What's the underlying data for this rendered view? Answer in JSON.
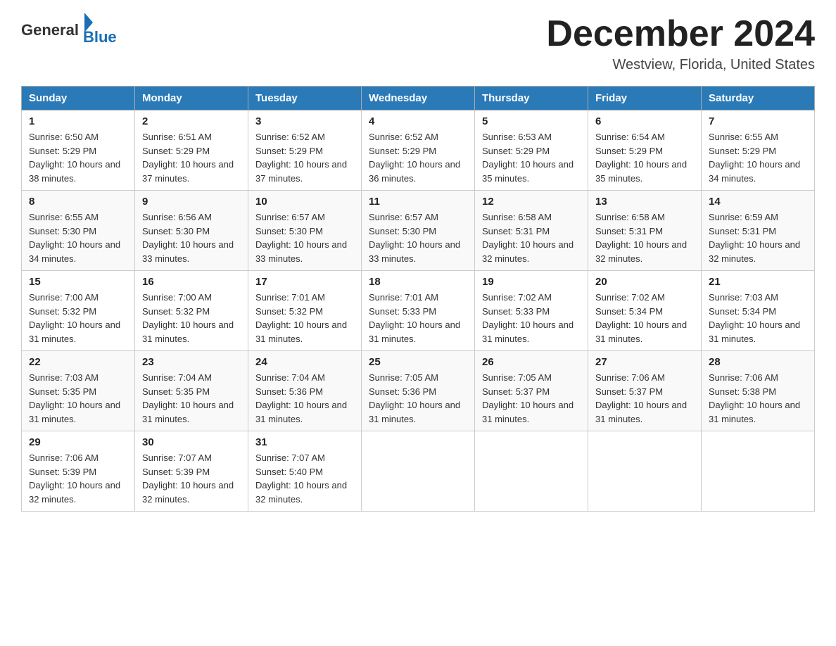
{
  "logo": {
    "text_general": "General",
    "text_blue": "Blue",
    "aria": "GeneralBlue logo"
  },
  "header": {
    "month_year": "December 2024",
    "location": "Westview, Florida, United States"
  },
  "weekdays": [
    "Sunday",
    "Monday",
    "Tuesday",
    "Wednesday",
    "Thursday",
    "Friday",
    "Saturday"
  ],
  "weeks": [
    [
      {
        "day": "1",
        "sunrise": "Sunrise: 6:50 AM",
        "sunset": "Sunset: 5:29 PM",
        "daylight": "Daylight: 10 hours and 38 minutes."
      },
      {
        "day": "2",
        "sunrise": "Sunrise: 6:51 AM",
        "sunset": "Sunset: 5:29 PM",
        "daylight": "Daylight: 10 hours and 37 minutes."
      },
      {
        "day": "3",
        "sunrise": "Sunrise: 6:52 AM",
        "sunset": "Sunset: 5:29 PM",
        "daylight": "Daylight: 10 hours and 37 minutes."
      },
      {
        "day": "4",
        "sunrise": "Sunrise: 6:52 AM",
        "sunset": "Sunset: 5:29 PM",
        "daylight": "Daylight: 10 hours and 36 minutes."
      },
      {
        "day": "5",
        "sunrise": "Sunrise: 6:53 AM",
        "sunset": "Sunset: 5:29 PM",
        "daylight": "Daylight: 10 hours and 35 minutes."
      },
      {
        "day": "6",
        "sunrise": "Sunrise: 6:54 AM",
        "sunset": "Sunset: 5:29 PM",
        "daylight": "Daylight: 10 hours and 35 minutes."
      },
      {
        "day": "7",
        "sunrise": "Sunrise: 6:55 AM",
        "sunset": "Sunset: 5:29 PM",
        "daylight": "Daylight: 10 hours and 34 minutes."
      }
    ],
    [
      {
        "day": "8",
        "sunrise": "Sunrise: 6:55 AM",
        "sunset": "Sunset: 5:30 PM",
        "daylight": "Daylight: 10 hours and 34 minutes."
      },
      {
        "day": "9",
        "sunrise": "Sunrise: 6:56 AM",
        "sunset": "Sunset: 5:30 PM",
        "daylight": "Daylight: 10 hours and 33 minutes."
      },
      {
        "day": "10",
        "sunrise": "Sunrise: 6:57 AM",
        "sunset": "Sunset: 5:30 PM",
        "daylight": "Daylight: 10 hours and 33 minutes."
      },
      {
        "day": "11",
        "sunrise": "Sunrise: 6:57 AM",
        "sunset": "Sunset: 5:30 PM",
        "daylight": "Daylight: 10 hours and 33 minutes."
      },
      {
        "day": "12",
        "sunrise": "Sunrise: 6:58 AM",
        "sunset": "Sunset: 5:31 PM",
        "daylight": "Daylight: 10 hours and 32 minutes."
      },
      {
        "day": "13",
        "sunrise": "Sunrise: 6:58 AM",
        "sunset": "Sunset: 5:31 PM",
        "daylight": "Daylight: 10 hours and 32 minutes."
      },
      {
        "day": "14",
        "sunrise": "Sunrise: 6:59 AM",
        "sunset": "Sunset: 5:31 PM",
        "daylight": "Daylight: 10 hours and 32 minutes."
      }
    ],
    [
      {
        "day": "15",
        "sunrise": "Sunrise: 7:00 AM",
        "sunset": "Sunset: 5:32 PM",
        "daylight": "Daylight: 10 hours and 31 minutes."
      },
      {
        "day": "16",
        "sunrise": "Sunrise: 7:00 AM",
        "sunset": "Sunset: 5:32 PM",
        "daylight": "Daylight: 10 hours and 31 minutes."
      },
      {
        "day": "17",
        "sunrise": "Sunrise: 7:01 AM",
        "sunset": "Sunset: 5:32 PM",
        "daylight": "Daylight: 10 hours and 31 minutes."
      },
      {
        "day": "18",
        "sunrise": "Sunrise: 7:01 AM",
        "sunset": "Sunset: 5:33 PM",
        "daylight": "Daylight: 10 hours and 31 minutes."
      },
      {
        "day": "19",
        "sunrise": "Sunrise: 7:02 AM",
        "sunset": "Sunset: 5:33 PM",
        "daylight": "Daylight: 10 hours and 31 minutes."
      },
      {
        "day": "20",
        "sunrise": "Sunrise: 7:02 AM",
        "sunset": "Sunset: 5:34 PM",
        "daylight": "Daylight: 10 hours and 31 minutes."
      },
      {
        "day": "21",
        "sunrise": "Sunrise: 7:03 AM",
        "sunset": "Sunset: 5:34 PM",
        "daylight": "Daylight: 10 hours and 31 minutes."
      }
    ],
    [
      {
        "day": "22",
        "sunrise": "Sunrise: 7:03 AM",
        "sunset": "Sunset: 5:35 PM",
        "daylight": "Daylight: 10 hours and 31 minutes."
      },
      {
        "day": "23",
        "sunrise": "Sunrise: 7:04 AM",
        "sunset": "Sunset: 5:35 PM",
        "daylight": "Daylight: 10 hours and 31 minutes."
      },
      {
        "day": "24",
        "sunrise": "Sunrise: 7:04 AM",
        "sunset": "Sunset: 5:36 PM",
        "daylight": "Daylight: 10 hours and 31 minutes."
      },
      {
        "day": "25",
        "sunrise": "Sunrise: 7:05 AM",
        "sunset": "Sunset: 5:36 PM",
        "daylight": "Daylight: 10 hours and 31 minutes."
      },
      {
        "day": "26",
        "sunrise": "Sunrise: 7:05 AM",
        "sunset": "Sunset: 5:37 PM",
        "daylight": "Daylight: 10 hours and 31 minutes."
      },
      {
        "day": "27",
        "sunrise": "Sunrise: 7:06 AM",
        "sunset": "Sunset: 5:37 PM",
        "daylight": "Daylight: 10 hours and 31 minutes."
      },
      {
        "day": "28",
        "sunrise": "Sunrise: 7:06 AM",
        "sunset": "Sunset: 5:38 PM",
        "daylight": "Daylight: 10 hours and 31 minutes."
      }
    ],
    [
      {
        "day": "29",
        "sunrise": "Sunrise: 7:06 AM",
        "sunset": "Sunset: 5:39 PM",
        "daylight": "Daylight: 10 hours and 32 minutes."
      },
      {
        "day": "30",
        "sunrise": "Sunrise: 7:07 AM",
        "sunset": "Sunset: 5:39 PM",
        "daylight": "Daylight: 10 hours and 32 minutes."
      },
      {
        "day": "31",
        "sunrise": "Sunrise: 7:07 AM",
        "sunset": "Sunset: 5:40 PM",
        "daylight": "Daylight: 10 hours and 32 minutes."
      },
      null,
      null,
      null,
      null
    ]
  ]
}
